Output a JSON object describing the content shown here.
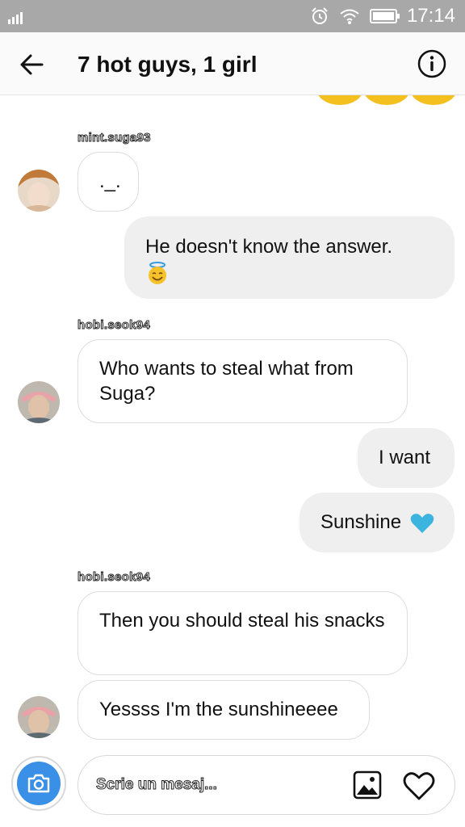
{
  "status_bar": {
    "time": "17:14",
    "icons": [
      "signal-icon",
      "alarm-icon",
      "wifi-icon",
      "battery-icon"
    ]
  },
  "header": {
    "title": "7 hot guys, 1 girl",
    "back_icon": "arrow-left-icon",
    "info_icon": "info-icon"
  },
  "messages": [
    {
      "sender": "mint.suga93",
      "text": "._.",
      "direction": "incoming"
    },
    {
      "text": "He doesn't know the answer.",
      "emoji": "smiling-face-with-halo",
      "direction": "outgoing"
    },
    {
      "sender": "hobi.seok94",
      "text": "Who wants to steal what from Suga?",
      "direction": "incoming"
    },
    {
      "text": "I want",
      "direction": "outgoing"
    },
    {
      "text": "Sunshine",
      "emoji": "blue-heart",
      "direction": "outgoing"
    },
    {
      "sender": "hobi.seok94",
      "text": "Then you should steal his snacks",
      "direction": "incoming"
    },
    {
      "text": "Yessss I'm the sunshineeee",
      "direction": "incoming"
    }
  ],
  "composer": {
    "placeholder": "Scrie un mesaj...",
    "camera_icon": "camera-icon",
    "gallery_icon": "image-icon",
    "like_icon": "heart-icon"
  },
  "colors": {
    "status_bar": "#a8a8a8",
    "camera_button": "#3a90e6",
    "blue_heart": "#3bb5e0",
    "outgoing_bubble": "#efefef"
  }
}
